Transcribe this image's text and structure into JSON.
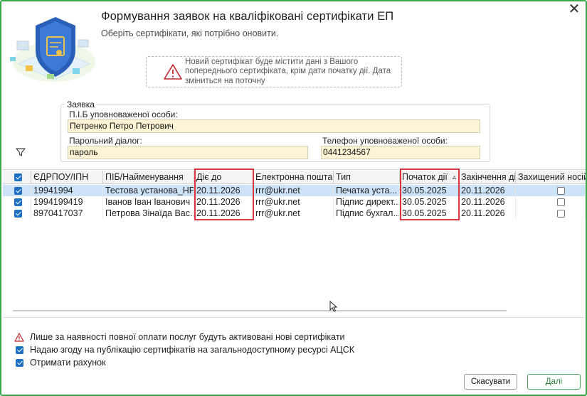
{
  "dialog": {
    "title": "Формування заявок на кваліфіковані сертифікати ЕП",
    "subtitle": "Оберіть сертифікати, які потрібно оновити.",
    "close_icon": "close-icon",
    "notice": "Новий сертифікат буде містити дані з Вашого попереднього сертифіката, крім дати початку дії. Дата зміниться на поточну"
  },
  "request": {
    "group_title": "Заявка",
    "person_label": "П.І.Б уповноваженої особи:",
    "person_value": "Петренко Петро Петрович",
    "password_label": "Парольний діалог:",
    "password_value": "пароль",
    "phone_label": "Телефон уповноваженої особи:",
    "phone_value": "0441234567"
  },
  "table": {
    "columns": [
      "ЄДРПОУ/ІПН",
      "ПІБ/Найменування",
      "Діє до",
      "Електронна пошта",
      "Тип",
      "Початок дії",
      "Закінчення дії",
      "Захищений носій"
    ],
    "sort_indicator": "▵",
    "rows": [
      {
        "checked": true,
        "selected": true,
        "edrpou": "19941994",
        "name": "Тестова установа_НР",
        "valid_to": "20.11.2026",
        "email": "rrr@ukr.net",
        "type": "Печатка уста...",
        "start": "30.05.2025",
        "end": "20.11.2026",
        "protected": false
      },
      {
        "checked": true,
        "selected": false,
        "edrpou": "1994199419",
        "name": "Іванов Іван Іванович",
        "valid_to": "20.11.2026",
        "email": "rrr@ukr.net",
        "type": "Підпис директ...",
        "start": "30.05.2025",
        "end": "20.11.2026",
        "protected": false
      },
      {
        "checked": true,
        "selected": false,
        "edrpou": "8970417037",
        "name": "Петрова Зінаїда Вас...",
        "valid_to": "20.11.2026",
        "email": "rrr@ukr.net",
        "type": "Підпис бухгал...",
        "start": "30.05.2025",
        "end": "20.11.2026",
        "protected": false
      }
    ]
  },
  "options": {
    "warning_text": "Лише за наявності повної оплати послуг будуть активовані нові сертифікати",
    "consent_text": "Надаю згоду на публікацію сертифікатів на загальнодоступному ресурсі АЦСК",
    "invoice_text": "Отримати рахунок",
    "consent_checked": true,
    "invoice_checked": true
  },
  "buttons": {
    "cancel": "Скасувати",
    "next": "Далі"
  },
  "colors": {
    "frame": "#3aa84a",
    "highlight": "#d9363e",
    "field_bg": "#fcf4d4",
    "selected_row": "#cde3f7",
    "checkbox": "#1f6fc4"
  }
}
